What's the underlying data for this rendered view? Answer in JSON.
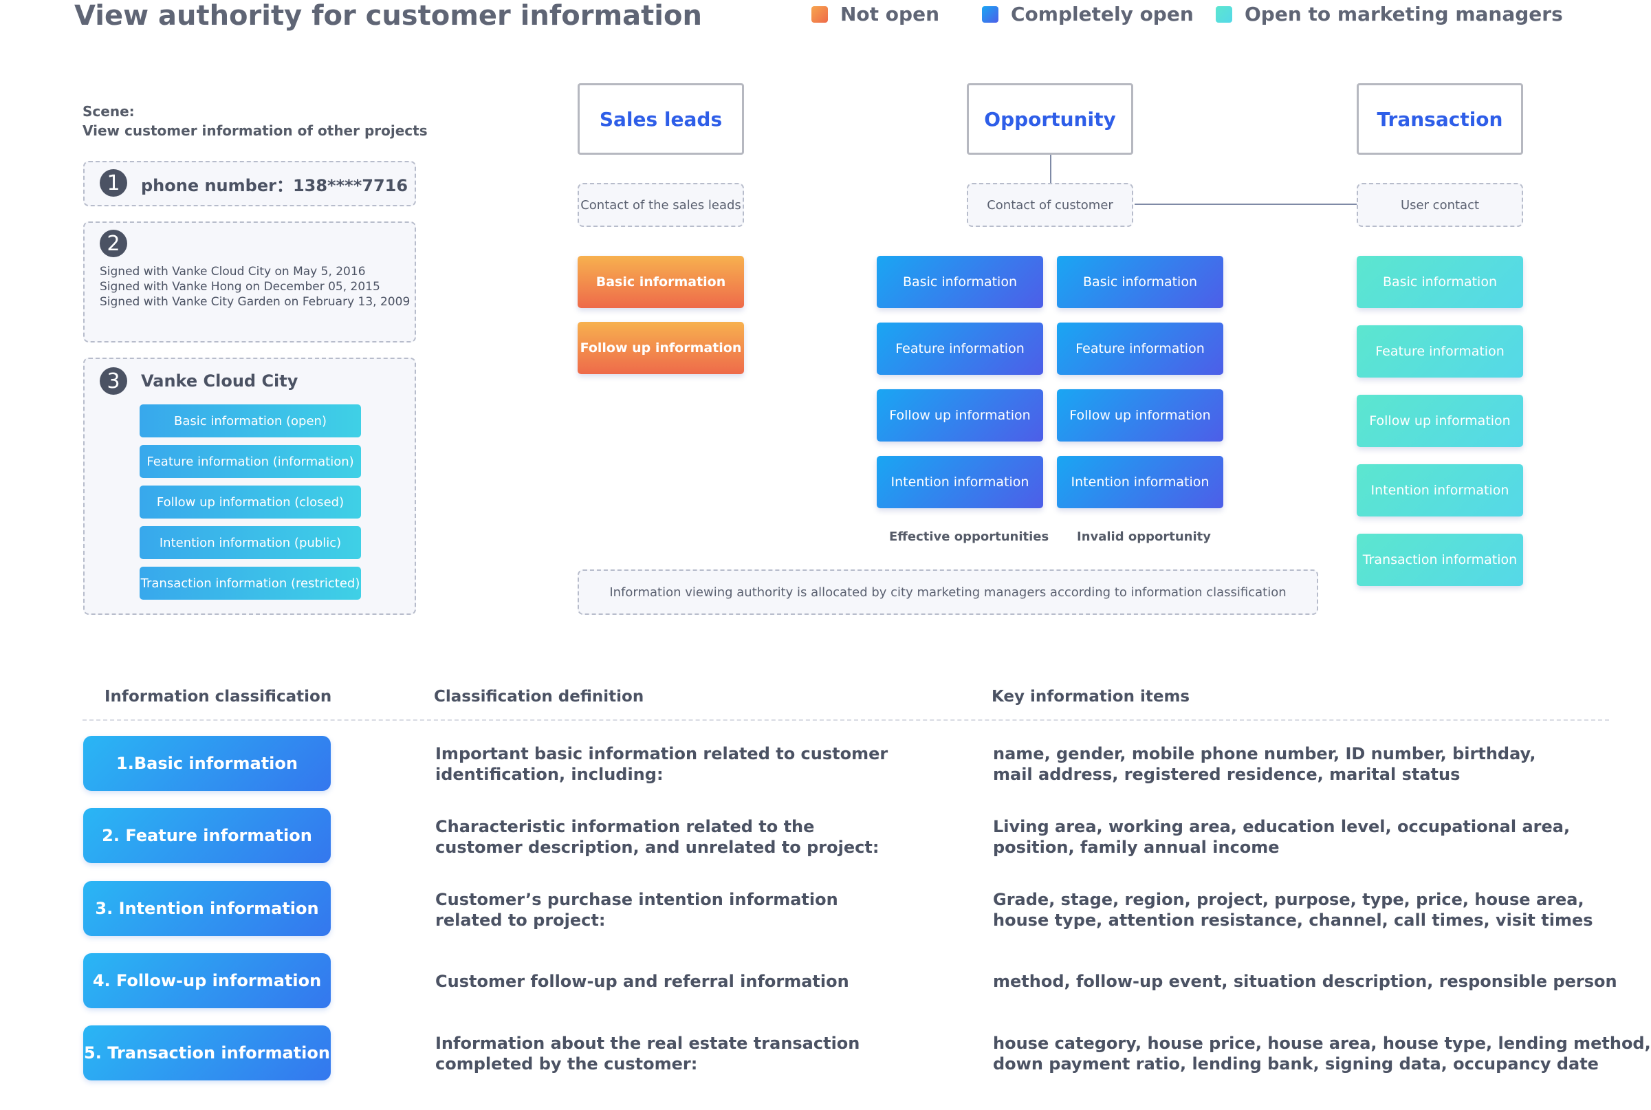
{
  "title": "View authority for customer information",
  "legend": [
    {
      "label": "Not open",
      "color": "#f07a48"
    },
    {
      "label": "Completely open",
      "color": "#2f80ee"
    },
    {
      "label": "Open to marketing managers",
      "color": "#56e0d2"
    }
  ],
  "scene": {
    "label": "Scene:",
    "text": "View customer information of other projects"
  },
  "card1": {
    "number": "1",
    "text": "phone number：138****7716"
  },
  "card2": {
    "number": "2",
    "lines": [
      "Signed with Vanke Cloud City on May 5, 2016",
      "Signed with Vanke Hong on December 05, 2015",
      "Signed with Vanke City Garden on February 13, 2009"
    ]
  },
  "card3": {
    "number": "3",
    "title": "Vanke Cloud City",
    "items": [
      "Basic information (open)",
      "Feature information (information)",
      "Follow up information (closed)",
      "Intention information (public)",
      "Transaction information (restricted)"
    ]
  },
  "stages": {
    "sales": {
      "title": "Sales leads",
      "contact": "Contact of the sales leads",
      "items": [
        "Basic information",
        "Follow up information"
      ]
    },
    "opportunity": {
      "title": "Opportunity",
      "contact": "Contact of customer",
      "effective": [
        "Basic information",
        "Feature information",
        "Follow up information",
        "Intention information"
      ],
      "invalid": [
        "Basic information",
        "Feature information",
        "Follow up information",
        "Intention information"
      ],
      "effective_caption": "Effective opportunities",
      "invalid_caption": "Invalid opportunity"
    },
    "transaction": {
      "title": "Transaction",
      "contact": "User contact",
      "items": [
        "Basic information",
        "Feature information",
        "Follow up information",
        "Intention information",
        "Transaction information"
      ]
    }
  },
  "note": "Information viewing authority is allocated by city marketing managers according to information classification",
  "table": {
    "headers": [
      "Information classification",
      "Classification definition",
      "Key information items"
    ],
    "rows": [
      {
        "name": "1.Basic information",
        "definition": [
          "Important basic information related to customer",
          "identification, including:"
        ],
        "items": [
          "name, gender, mobile phone number, ID number, birthday,",
          "mail address, registered residence, marital status"
        ]
      },
      {
        "name": "2. Feature information",
        "definition": [
          "Characteristic information related to the",
          "customer description, and unrelated to project:"
        ],
        "items": [
          "Living area, working area, education level, occupational area,",
          "position, family annual income"
        ]
      },
      {
        "name": "3. Intention information",
        "definition": [
          "Customer’s purchase intention information",
          "related to project:"
        ],
        "items": [
          "Grade, stage, region, project, purpose, type, price, house area,",
          "house type, attention resistance, channel, call times, visit times"
        ]
      },
      {
        "name": "4. Follow-up information",
        "definition": [
          "Customer follow-up and referral information"
        ],
        "items": [
          "method, follow-up event, situation description, responsible person"
        ]
      },
      {
        "name": "5. Transaction information",
        "definition": [
          "Information about the real estate transaction",
          "completed by the customer:"
        ],
        "items": [
          "house category, house price, house area, house type, lending method,",
          "down payment ratio, lending bank, signing data, occupancy date"
        ]
      }
    ]
  }
}
